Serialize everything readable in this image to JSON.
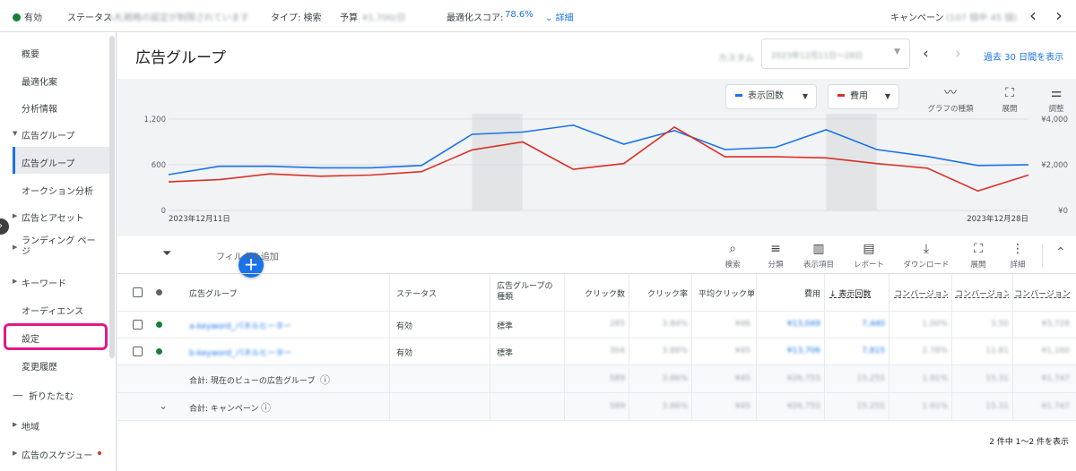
{
  "topbar": {
    "status": "有効",
    "status_label": "ステータス",
    "status_value": "入札戦略の設定が制限されています",
    "type_label": "タイプ: 検索",
    "budget_label": "予算",
    "budget_value": "¥1,700/日",
    "score_label": "最適化スコア:",
    "score_value": "78.6%",
    "details": "詳細",
    "campaign_label": "キャンペーン",
    "campaign_count": "(107 個中 45 個)",
    "prev": "‹",
    "next": "›"
  },
  "sidebar": {
    "items": [
      "概要",
      "最適化案",
      "分析情報",
      "広告グループ",
      "広告グループ",
      "オークション分析",
      "広告とアセット",
      "ランディング ペー\nジ",
      "キーワード",
      "オーディエンス",
      "設定",
      "変更履歴",
      "折りたたむ",
      "地域",
      "広告のスケジュー"
    ]
  },
  "main": {
    "title": "広告グループ",
    "custom_label": "カスタム",
    "date_range": "2023年12月11日〜28日",
    "show_last": "過去 30 日間を表示"
  },
  "chart_controls": {
    "metric1": "表示回数",
    "metric2": "費用",
    "chart_type": "グラフの種類",
    "expand": "展開",
    "adjust": "調整",
    "metric1_color": "#1a73e8",
    "metric2_color": "#d93025"
  },
  "chart_data": {
    "type": "line",
    "x": [
      "2023年12月11日",
      "",
      "",
      "",
      "",
      "",
      "",
      "",
      "",
      "",
      "",
      "",
      "",
      "",
      "",
      "",
      "",
      "2023年12月28日"
    ],
    "series": [
      {
        "name": "表示回数",
        "axis": "left",
        "values": [
          470,
          580,
          580,
          560,
          560,
          590,
          1000,
          1030,
          1120,
          870,
          1050,
          800,
          830,
          1060,
          800,
          710,
          590,
          600
        ]
      },
      {
        "name": "費用",
        "axis": "right",
        "values": [
          1250,
          1350,
          1600,
          1500,
          1550,
          1700,
          2650,
          3000,
          1800,
          2050,
          3650,
          2350,
          2350,
          2300,
          2050,
          1850,
          850,
          1550
        ]
      }
    ],
    "ylim_left": [
      0,
      1200
    ],
    "yticks_left": [
      "0",
      "600",
      "1,200"
    ],
    "ylim_right": [
      0,
      4000
    ],
    "yticks_right": [
      "¥0",
      "¥2,000",
      "¥4,000"
    ],
    "x_start_label": "2023年12月11日",
    "x_end_label": "2023年12月28日",
    "weekend_shading": [
      [
        6,
        7
      ],
      [
        13,
        14
      ]
    ],
    "grid": true
  },
  "toolbar": {
    "filter_add": "フィルタを追加",
    "search": "検索",
    "segment": "分類",
    "columns": "表示項目",
    "report": "レポート",
    "download": "ダウンロード",
    "expand": "展開",
    "more": "詳細"
  },
  "table": {
    "headers": [
      "広告グループ",
      "ステータス",
      "広告グループの種類",
      "クリック数",
      "クリック率",
      "平均クリック単",
      "費用",
      "↓ 表示回数",
      "コンバージョン",
      "コンバージョン",
      "コンバージョン"
    ],
    "rows": [
      {
        "name": "a-keyword_パネルヒーター",
        "status": "有効",
        "type": "標準",
        "vals": [
          "285",
          "3.84%",
          "¥46",
          "¥13,049",
          "7,440",
          "1.00%",
          "3.50",
          "¥3,728"
        ]
      },
      {
        "name": "b-keyword_パネルヒーター",
        "status": "有効",
        "type": "標準",
        "vals": [
          "304",
          "3.88%",
          "¥45",
          "¥13,706",
          "7,815",
          "2.78%",
          "11.81",
          "¥1,160"
        ]
      }
    ],
    "total1": "合計: 現在のビューの広告グループ",
    "total1_vals": [
      "589",
      "3.86%",
      "¥45",
      "¥26,755",
      "15,255",
      "1.91%",
      "15.31",
      "¥1,747"
    ],
    "total2": "合計: キャンペーン",
    "total2_vals": [
      "589",
      "3.86%",
      "¥45",
      "¥26,755",
      "15,255",
      "1.91%",
      "15.31",
      "¥1,747"
    ],
    "pagination": "2 件中 1〜2 件を表示"
  }
}
